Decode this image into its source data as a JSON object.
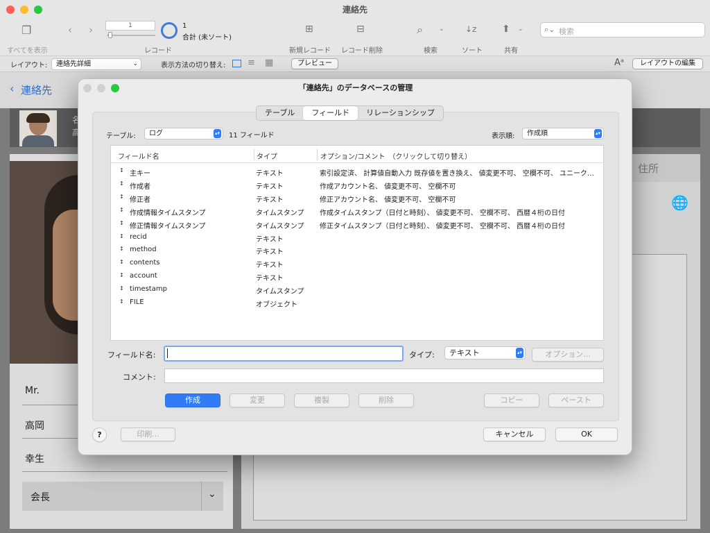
{
  "window": {
    "title": "連絡先",
    "colors": {
      "close": "#fe5f57",
      "minimize": "#febc2e",
      "zoom": "#28c840"
    }
  },
  "toolbar": {
    "show_all_label": "すべてを表示",
    "record_input_value": "1",
    "record_label": "レコード",
    "found_count": "1",
    "total_label": "合計 (未ソート)",
    "new_record_label": "新規レコード",
    "delete_record_label": "レコード削除",
    "find_label": "検索",
    "sort_label": "ソート",
    "share_label": "共有",
    "search_placeholder": "検索"
  },
  "layoutbar": {
    "layout_label": "レイアウト:",
    "layout_value": "連絡先詳細",
    "view_as_label": "表示方法の切り替え:",
    "preview_label": "プレビュー",
    "edit_layout_label": "レイアウトの編集"
  },
  "background": {
    "back_label": "連絡先",
    "name_prefix": "名",
    "name_prefix2": "高",
    "tab_address": "住所",
    "title_value": "Mr.",
    "last_name": "高岡",
    "first_name": "幸生",
    "position": "会長"
  },
  "dialog": {
    "title": "「連絡先」のデータベースの管理",
    "tabs": [
      {
        "label": "テーブル",
        "selected": false
      },
      {
        "label": "フィールド",
        "selected": true
      },
      {
        "label": "リレーションシップ",
        "selected": false
      }
    ],
    "table_label": "テーブル:",
    "table_value": "ログ",
    "field_count": "11 フィールド",
    "order_label": "表示順:",
    "order_value": "作成順",
    "columns": {
      "name": "フィールド名",
      "type": "タイプ",
      "options": "オプション/コメント　（クリックして切り替え）"
    },
    "fields": [
      {
        "name": "主キー",
        "type": "テキスト",
        "options": "索引設定済、 計算値自動入力  既存値を置き換え、 値変更不可、 空欄不可、 ユニーク…"
      },
      {
        "name": "作成者",
        "type": "テキスト",
        "options": "作成アカウント名、 値変更不可、 空欄不可"
      },
      {
        "name": "修正者",
        "type": "テキスト",
        "options": "修正アカウント名、 値変更不可、 空欄不可"
      },
      {
        "name": "作成情報タイムスタンプ",
        "type": "タイムスタンプ",
        "options": "作成タイムスタンプ（日付と時刻）、 値変更不可、 空欄不可、 西暦４桁の日付"
      },
      {
        "name": "修正情報タイムスタンプ",
        "type": "タイムスタンプ",
        "options": "修正タイムスタンプ（日付と時刻）、 値変更不可、 空欄不可、 西暦４桁の日付"
      },
      {
        "name": "recid",
        "type": "テキスト",
        "options": ""
      },
      {
        "name": "method",
        "type": "テキスト",
        "options": ""
      },
      {
        "name": "contents",
        "type": "テキスト",
        "options": ""
      },
      {
        "name": "account",
        "type": "テキスト",
        "options": ""
      },
      {
        "name": "timestamp",
        "type": "タイムスタンプ",
        "options": ""
      },
      {
        "name": "FILE",
        "type": "オブジェクト",
        "options": ""
      }
    ],
    "field_name_label": "フィールド名:",
    "field_name_value": "",
    "type_label": "タイプ:",
    "type_value": "テキスト",
    "options_button": "オプション...",
    "comment_label": "コメント:",
    "comment_value": "",
    "create_button": "作成",
    "change_button": "変更",
    "duplicate_button": "複製",
    "delete_button": "削除",
    "copy_button": "コピー",
    "paste_button": "ペースト",
    "help_button": "?",
    "print_button": "印刷...",
    "cancel_button": "キャンセル",
    "ok_button": "OK"
  }
}
